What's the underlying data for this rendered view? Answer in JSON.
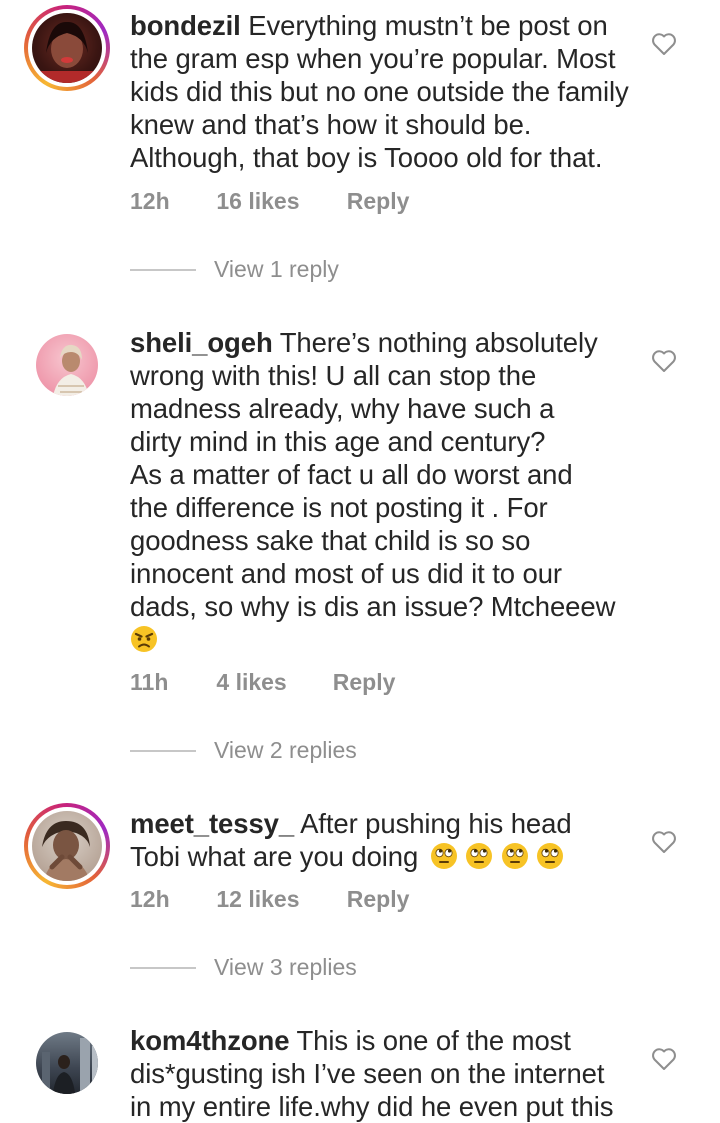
{
  "comments": [
    {
      "username": "bondezil",
      "text": "Everything mustn’t be post on the gram esp when you’re popular. Most kids did this but no one outside the family knew and that’s how it should be. Although, that boy is Toooo old for that.",
      "time": "12h",
      "likes": "16 likes",
      "reply": "Reply",
      "view_replies": "View 1 reply"
    },
    {
      "username": "sheli_ogeh",
      "text_lines": [
        "There’s nothing absolutely",
        "wrong with this! U all can stop the",
        "madness already, why have such a",
        "dirty mind in this age and century?",
        "As a matter of fact u all do worst and",
        "the difference is not posting it . For",
        "goodness sake that child is so so",
        "innocent and most of us did it to our",
        "dads, so why is dis an issue? Mtcheeew"
      ],
      "emoji": "angry-face",
      "time": "11h",
      "likes": "4 likes",
      "reply": "Reply",
      "view_replies": "View 2 replies"
    },
    {
      "username": "meet_tessy_",
      "text_lines": [
        "After pushing his head",
        "Tobi what are you doing"
      ],
      "emoji": "rolling-eyes-face x4",
      "time": "12h",
      "likes": "12 likes",
      "reply": "Reply",
      "view_replies": "View 3 replies"
    },
    {
      "username": "kom4thzone",
      "text_lines": [
        "This is one of the most",
        "dis*gusting ish I’ve seen on the internet",
        "in my entire life.why did he even put this"
      ]
    }
  ],
  "icons": {
    "like": "heart-outline-icon"
  },
  "colors": {
    "text": "#262626",
    "secondary": "#8e8e8e",
    "divider": "#c7c7c7"
  }
}
